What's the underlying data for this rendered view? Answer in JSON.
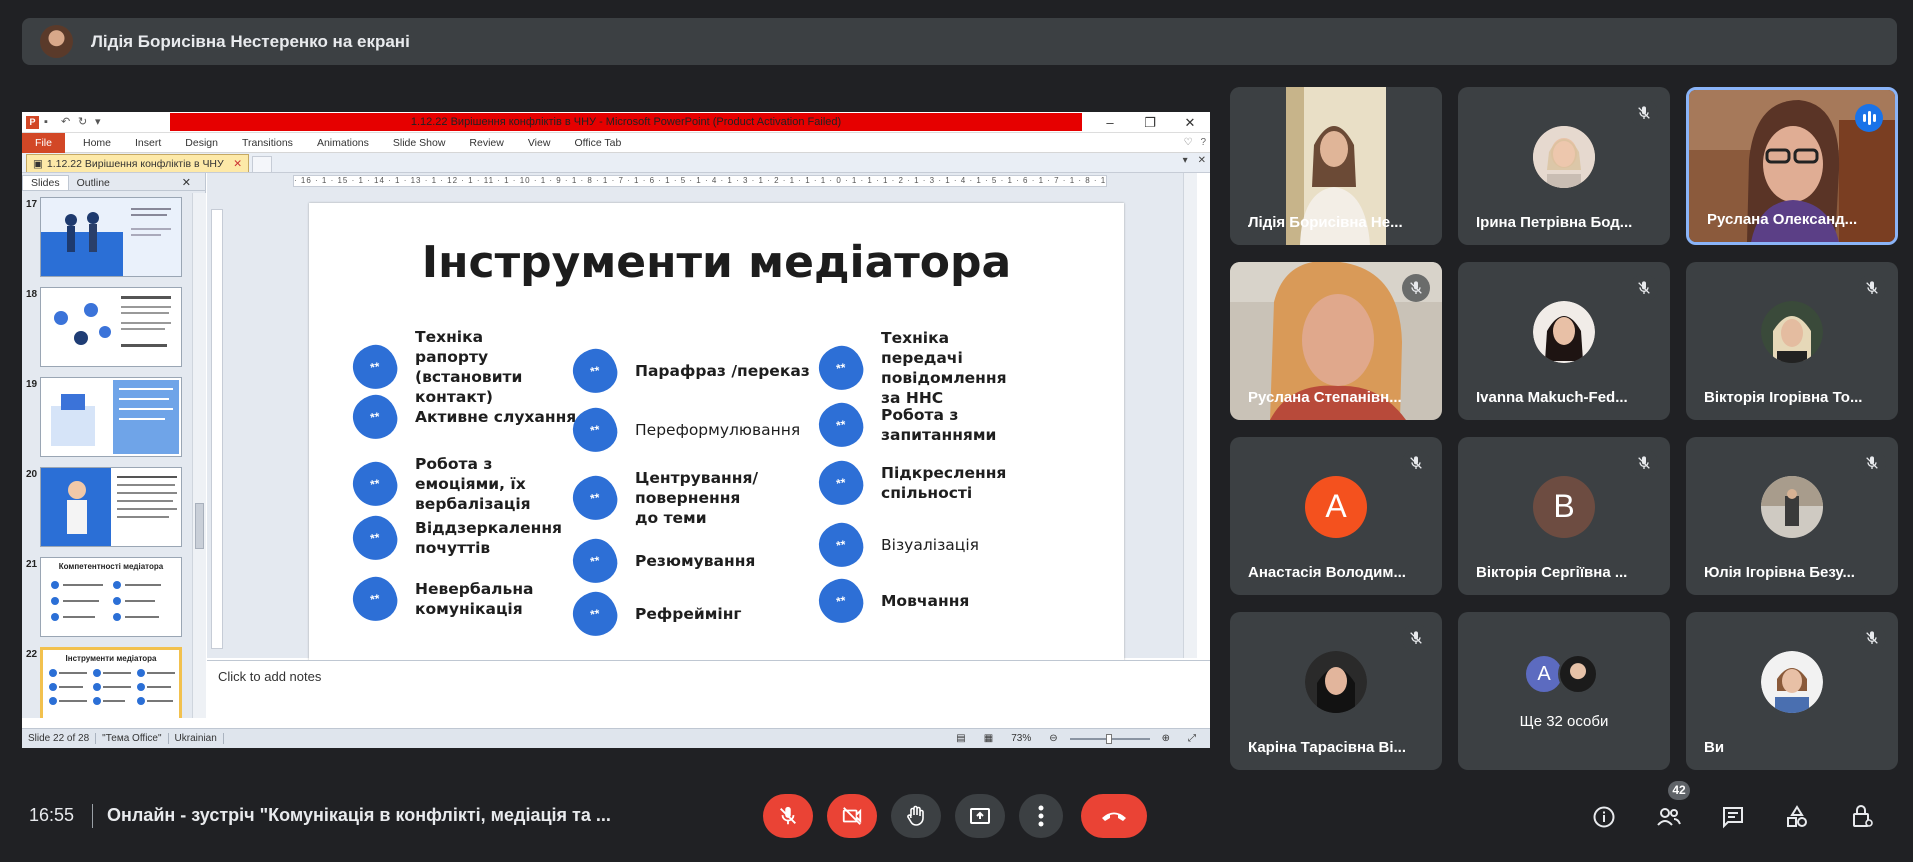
{
  "banner": {
    "text": "Лідія Борисівна Нестеренко на екрані"
  },
  "ppt": {
    "window_title": "1.12.22 Вирішення конфліктів в ЧНУ  -  Microsoft PowerPoint (Product Activation Failed)",
    "ribbon_tabs": [
      "File",
      "Home",
      "Insert",
      "Design",
      "Transitions",
      "Animations",
      "Slide Show",
      "Review",
      "View",
      "Office Tab"
    ],
    "doc_tab": "1.12.22 Вирішення конфліктів в ЧНУ",
    "pane_tabs": [
      "Slides",
      "Outline"
    ],
    "thumbs": [
      {
        "num": "17",
        "title": ""
      },
      {
        "num": "18",
        "title": ""
      },
      {
        "num": "19",
        "title": ""
      },
      {
        "num": "20",
        "title": ""
      },
      {
        "num": "21",
        "title": "Компетентності медіатора"
      },
      {
        "num": "22",
        "title": "Інструменти медіатора"
      }
    ],
    "ruler_text": "· 16 · 1 · 15 · 1 · 14 · 1 · 13 · 1 · 12 · 1 · 11 · 1 · 10 · 1 · 9 · 1 · 8 · 1 · 7 · 1 · 6 · 1 · 5 · 1 · 4 · 1 · 3 · 1 · 2 · 1 · 1 · 1 · 0 · 1 · 1 · 1 · 2 · 1 · 3 · 1 · 4 · 1 · 5 · 1 · 6 · 1 · 7 · 1 · 8 · 1 · 9 · 1 · 10 · 1 · 11 · 1 · 12 · 1 · 13 · 1 · 14 · 1 · 15 · 1 · 16 ·",
    "slide": {
      "title": "Інструменти медіатора",
      "bullet_mark": "**",
      "items": [
        "Техніка рапорту (встановити контакт)",
        "Активне слухання",
        "Робота з емоціями, їх вербалізація",
        "Віддзеркалення почуттів",
        "Невербальна комунікація",
        "Парафраз /переказ",
        "Переформулювання",
        "Центрування/ повернення до теми",
        "Резюмування",
        "Рефреймінг",
        "Техніка передачі повідомлення за ННС",
        "Робота з запитаннями",
        "Підкреслення спільності",
        "Візуалізація",
        "Мовчання"
      ]
    },
    "notes_placeholder": "Click to add notes",
    "status": {
      "slide": "Slide 22 of 28",
      "theme": "\"Тема Office\"",
      "lang": "Ukrainian",
      "zoom": "73%"
    }
  },
  "tiles": [
    {
      "name": "Лідія Борисівна Не..."
    },
    {
      "name": "Ірина Петрівна Бод..."
    },
    {
      "name": "Руслана Олександ..."
    },
    {
      "name": "Руслана Степанівн..."
    },
    {
      "name": "Ivanna Makuch-Fed..."
    },
    {
      "name": "Вікторія Ігорівна То..."
    },
    {
      "name": "Анастасія Володим...",
      "initial": "А"
    },
    {
      "name": "Вікторія Сергіївна ...",
      "initial": "В"
    },
    {
      "name": "Юлія Ігорівна Безу..."
    },
    {
      "name": "Каріна Тарасівна Ві..."
    },
    {
      "name": "Ще 32 особи",
      "initial": "A"
    },
    {
      "name": "Ви"
    }
  ],
  "colors": {
    "anastasia": "#f4511e",
    "viktoria": "#6d4c41",
    "a_small": "#5c6bc0",
    "accent": "#8ab4f8",
    "end_call": "#ea4335"
  },
  "bottom": {
    "time": "16:55",
    "meeting_title": "Онлайн - зустріч \"Комунікація в конфлікті, медіація та ...",
    "participants_count": "42"
  }
}
